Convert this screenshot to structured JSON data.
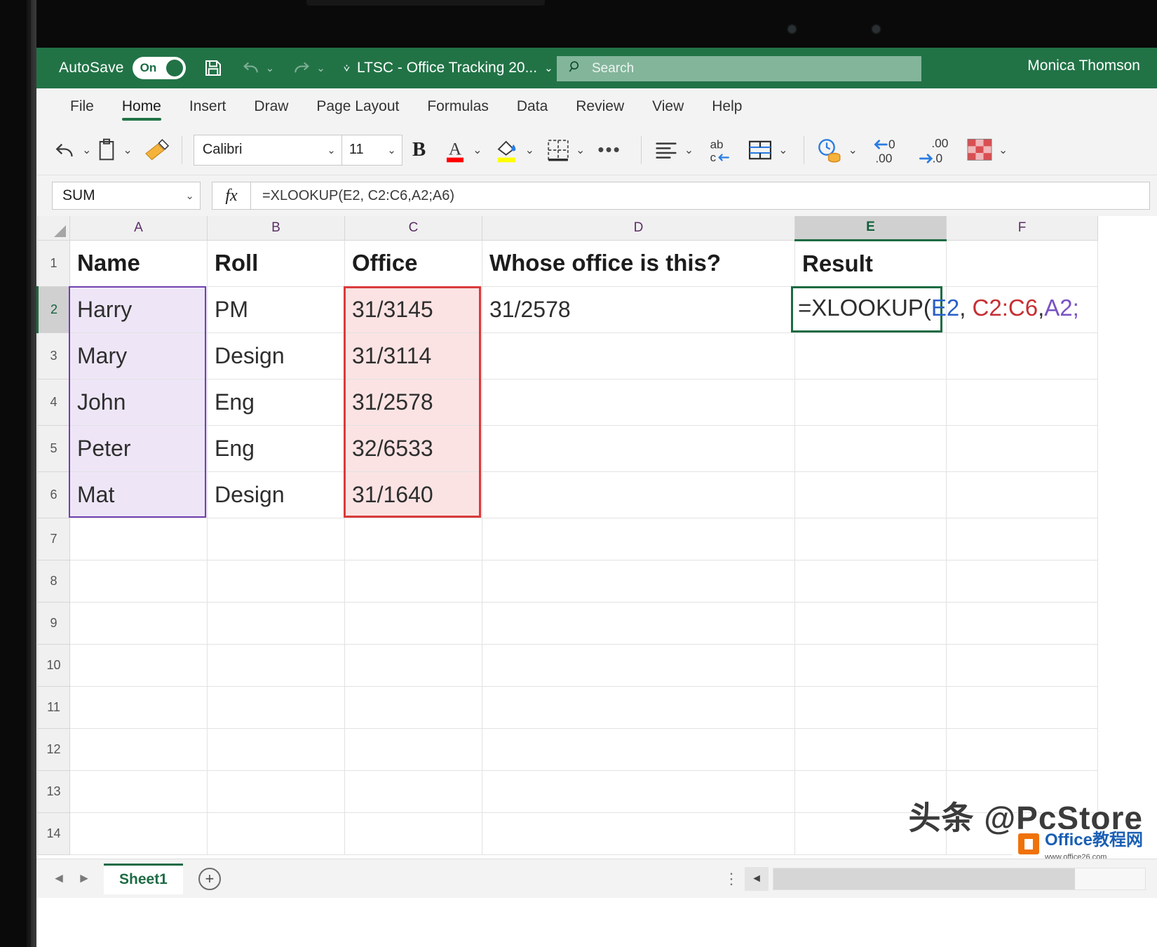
{
  "titlebar": {
    "autosave_label": "AutoSave",
    "autosave_state": "On",
    "save_icon": "save-icon",
    "undo_icon": "undo-icon",
    "redo_icon": "redo-icon",
    "document_title": "LTSC - Office Tracking 20...",
    "search_placeholder": "Search",
    "search_icon": "search-icon",
    "user_name": "Monica Thomson",
    "accent_color": "#217346"
  },
  "ribbon_tabs": [
    {
      "label": "File",
      "active": false
    },
    {
      "label": "Home",
      "active": true
    },
    {
      "label": "Insert",
      "active": false
    },
    {
      "label": "Draw",
      "active": false
    },
    {
      "label": "Page Layout",
      "active": false
    },
    {
      "label": "Formulas",
      "active": false
    },
    {
      "label": "Data",
      "active": false
    },
    {
      "label": "Review",
      "active": false
    },
    {
      "label": "View",
      "active": false
    },
    {
      "label": "Help",
      "active": false
    }
  ],
  "ribbon": {
    "undo_icon": "undo-icon",
    "paste_icon": "paste-clipboard-icon",
    "format_painter_icon": "format-painter-icon",
    "font_name": "Calibri",
    "font_size": "11",
    "bold_label": "B",
    "font_color_icon": "font-color-icon",
    "font_color_swatch": "#ff0000",
    "fill_color_icon": "fill-color-icon",
    "fill_color_swatch": "#ffff00",
    "borders_icon": "borders-icon",
    "more_icon": "more-options-icon",
    "align_icon": "align-left-icon",
    "wrap_text_icon": "wrap-text-icon",
    "merge_cells_icon": "merge-cells-icon",
    "number_format_icon": "number-format-accounting-icon",
    "decrease_decimal_icon": "decrease-decimal-icon",
    "decrease_decimal_label_top": "←.0",
    "decrease_decimal_label_bottom": ".00",
    "increase_decimal_icon": "increase-decimal-icon",
    "increase_decimal_label_top": ".00",
    "increase_decimal_label_bottom": "→.0",
    "cell_styles_icon": "cell-styles-icon"
  },
  "formula_bar": {
    "name_box_value": "SUM",
    "fx_label": "fx",
    "formula_value": "=XLOOKUP(E2, C2:C6,A2;A6)"
  },
  "grid": {
    "column_headers": [
      "A",
      "B",
      "C",
      "D",
      "E",
      "F"
    ],
    "selected_column": "E",
    "selected_row": "2",
    "row_numbers": [
      "1",
      "2",
      "3",
      "4",
      "5",
      "6",
      "7",
      "8",
      "9",
      "10",
      "11",
      "12",
      "13",
      "14"
    ],
    "rows": [
      {
        "num": "1",
        "A": "Name",
        "B": "Roll",
        "C": "Office",
        "D": "Whose office is this?",
        "E": "Result",
        "F": ""
      },
      {
        "num": "2",
        "A": "Harry",
        "B": "PM",
        "C": "31/3145",
        "D": "31/2578",
        "E": "",
        "F": ""
      },
      {
        "num": "3",
        "A": "Mary",
        "B": "Design",
        "C": "31/3114",
        "D": "",
        "E": "",
        "F": ""
      },
      {
        "num": "4",
        "A": "John",
        "B": "Eng",
        "C": "31/2578",
        "D": "",
        "E": "",
        "F": ""
      },
      {
        "num": "5",
        "A": "Peter",
        "B": "Eng",
        "C": "32/6533",
        "D": "",
        "E": "",
        "F": ""
      },
      {
        "num": "6",
        "A": "Mat",
        "B": "Design",
        "C": "31/1640",
        "D": "",
        "E": "",
        "F": ""
      },
      {
        "num": "7",
        "A": "",
        "B": "",
        "C": "",
        "D": "",
        "E": "",
        "F": ""
      },
      {
        "num": "8",
        "A": "",
        "B": "",
        "C": "",
        "D": "",
        "E": "",
        "F": ""
      },
      {
        "num": "9",
        "A": "",
        "B": "",
        "C": "",
        "D": "",
        "E": "",
        "F": ""
      },
      {
        "num": "10",
        "A": "",
        "B": "",
        "C": "",
        "D": "",
        "E": "",
        "F": ""
      },
      {
        "num": "11",
        "A": "",
        "B": "",
        "C": "",
        "D": "",
        "E": "",
        "F": ""
      },
      {
        "num": "12",
        "A": "",
        "B": "",
        "C": "",
        "D": "",
        "E": "",
        "F": ""
      },
      {
        "num": "13",
        "A": "",
        "B": "",
        "C": "",
        "D": "",
        "E": "",
        "F": ""
      },
      {
        "num": "14",
        "A": "",
        "B": "",
        "C": "",
        "D": "",
        "E": "",
        "F": ""
      }
    ],
    "active_cell_formula": {
      "part_prefix": "=XLOOKUP(",
      "part_arg1": "E2",
      "part_sep1": ", ",
      "part_arg2": "C2:C6",
      "part_sep2": ",",
      "part_arg3": "A2;",
      "arg1_color": "#2a5fc9",
      "arg2_color": "#c62f33",
      "arg3_color": "#7a52c4"
    },
    "highlights": {
      "lookup_array_range": "C2:C6",
      "lookup_array_color": "#d93b3b",
      "return_array_range": "A2:A6",
      "return_array_color": "#7040b0",
      "active_cell": "E2",
      "active_cell_color": "#1b6b42"
    }
  },
  "tabbar": {
    "prev_arrow": "◄",
    "next_arrow": "►",
    "sheet_name": "Sheet1",
    "add_sheet_icon": "add-sheet-icon",
    "add_sheet_label": "+",
    "options_icon": "more-vertical-icon",
    "scroll_left_icon": "scroll-left-icon"
  },
  "watermarks": {
    "main": "头条 @PcStore",
    "logo_text": "Office教程网",
    "logo_sub": "www.office26.com",
    "logo_icon": "house-icon"
  }
}
